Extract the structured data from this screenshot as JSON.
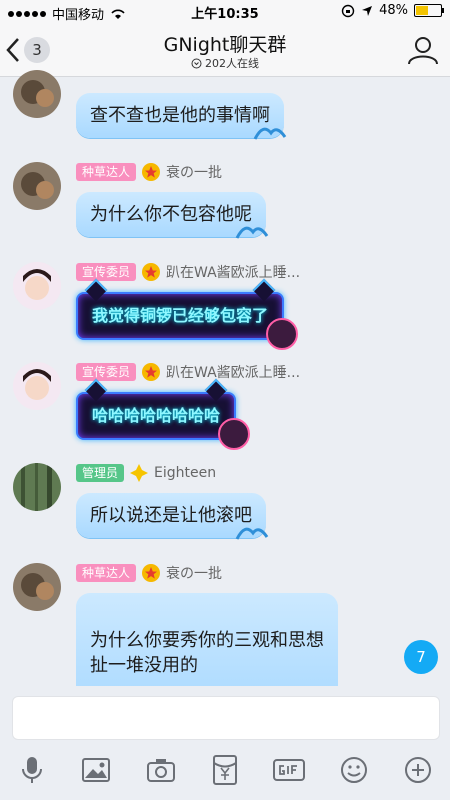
{
  "status_bar": {
    "carrier": "中国移动",
    "time": "上午10:35",
    "battery": "48%",
    "battery_level": 0.48
  },
  "nav": {
    "back_count": "3",
    "title": "GNight聊天群",
    "online": "202人在线"
  },
  "messages": [
    {
      "role": "",
      "name": "",
      "text": "查不查也是他的事情啊",
      "avatar": "avatar-dragon",
      "partial": true
    },
    {
      "role": "种草达人",
      "name": "衰の一批",
      "text": "为什么你不包容他呢",
      "avatar": "avatar-dragon"
    },
    {
      "role": "宣传委员",
      "name": "趴在WA酱欧派上睡...",
      "text": "我觉得铜锣已经够包容了",
      "avatar": "avatar-girl",
      "neon": true
    },
    {
      "role": "宣传委员",
      "name": "趴在WA酱欧派上睡...",
      "text": "哈哈哈哈哈哈哈哈",
      "avatar": "avatar-girl",
      "neon": true
    },
    {
      "role": "管理员",
      "name": "Eighteen",
      "text": "所以说还是让他滚吧",
      "avatar": "avatar-forest"
    },
    {
      "role": "种草达人",
      "name": "衰の一批",
      "text": "为什么你要秀你的三观和思想\n扯一堆没用的",
      "avatar": "avatar-dragon"
    }
  ],
  "unread_badge": "7",
  "toolbar": [
    "mic-icon",
    "image-icon",
    "camera-icon",
    "red-packet-icon",
    "gif-icon",
    "emoji-icon",
    "plus-icon"
  ],
  "colors": {
    "bubble": "#a9d9ff",
    "tag_pink": "#f98fbe",
    "tag_green": "#56c689",
    "accent": "#14aaf5"
  }
}
